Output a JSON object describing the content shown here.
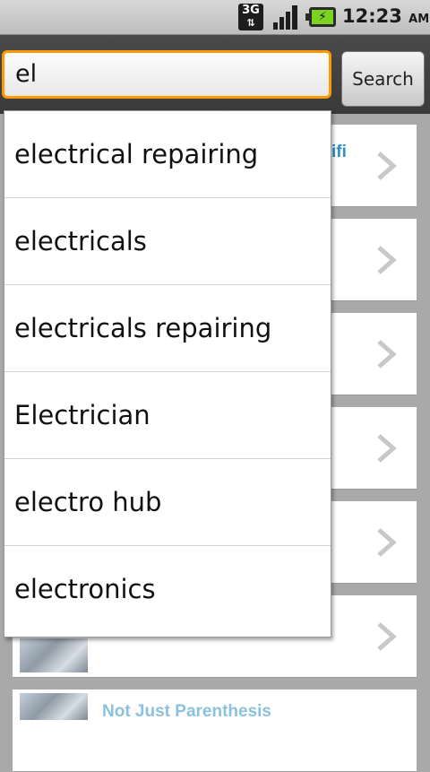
{
  "status_bar": {
    "network": "3G",
    "battery_icon": "battery-charging-icon",
    "time": "12:23",
    "ampm": "AM"
  },
  "search": {
    "query": "el",
    "button_label": "Search"
  },
  "suggestions": [
    "electrical repairing",
    "electricals",
    "electricals repairing",
    "Electrician",
    "electro hub",
    "electronics"
  ],
  "background_list": {
    "first_item_text": "ifi",
    "last_item_text": "Not Just Parenthesis"
  },
  "colors": {
    "accent": "#ff9900",
    "link": "#2d8fc6",
    "battery": "#7bd21f"
  }
}
